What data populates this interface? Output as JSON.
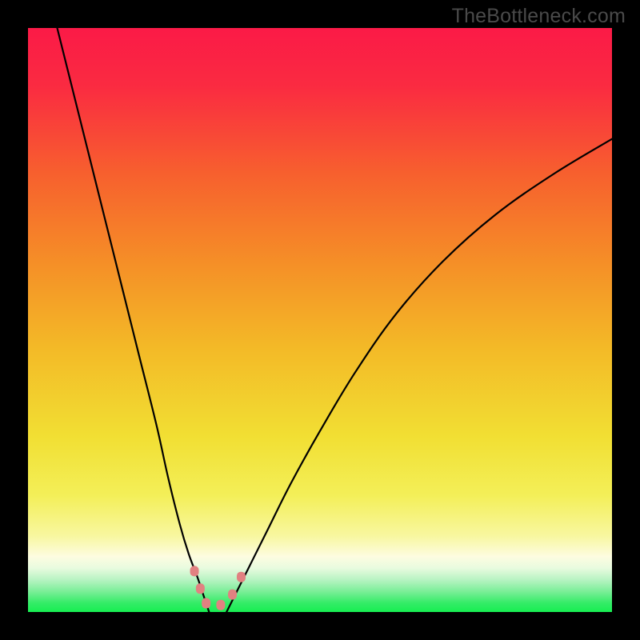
{
  "watermark": {
    "text": "TheBottleneck.com"
  },
  "colors": {
    "background": "#000000",
    "gradient_top": "#fb1a47",
    "gradient_mid_upper": "#f76a2d",
    "gradient_mid": "#f3b327",
    "gradient_mid_lower": "#f4e841",
    "gradient_yellow_pale": "#fbf8b5",
    "gradient_green_light": "#b5f2c1",
    "gradient_green": "#1fef5a",
    "curve": "#000000",
    "marker": "#e18181"
  },
  "chart_data": {
    "type": "line",
    "title": "",
    "xlabel": "",
    "ylabel": "",
    "xlim": [
      0,
      100
    ],
    "ylim": [
      0,
      100
    ],
    "grid": false,
    "series": [
      {
        "name": "left-branch",
        "x": [
          5,
          7,
          10,
          13,
          16,
          19,
          22,
          24,
          26,
          27.5,
          29,
          30,
          31
        ],
        "y": [
          100,
          92,
          80,
          68,
          56,
          44,
          32,
          23,
          15,
          10,
          6,
          3,
          0
        ]
      },
      {
        "name": "right-branch",
        "x": [
          34,
          36,
          38,
          41,
          45,
          50,
          56,
          63,
          71,
          80,
          90,
          100
        ],
        "y": [
          0,
          4,
          8,
          14,
          22,
          31,
          41,
          51,
          60,
          68,
          75,
          81
        ]
      }
    ],
    "markers": [
      {
        "name": "marker-left-upper",
        "x": 28.5,
        "y": 7
      },
      {
        "name": "marker-left-lower",
        "x": 29.5,
        "y": 4
      },
      {
        "name": "marker-left-bottom",
        "x": 30.5,
        "y": 1.5
      },
      {
        "name": "marker-mid-bottom",
        "x": 33.0,
        "y": 1.2
      },
      {
        "name": "marker-right-bottom",
        "x": 35.0,
        "y": 3
      },
      {
        "name": "marker-right-upper",
        "x": 36.5,
        "y": 6
      }
    ],
    "annotations": []
  }
}
